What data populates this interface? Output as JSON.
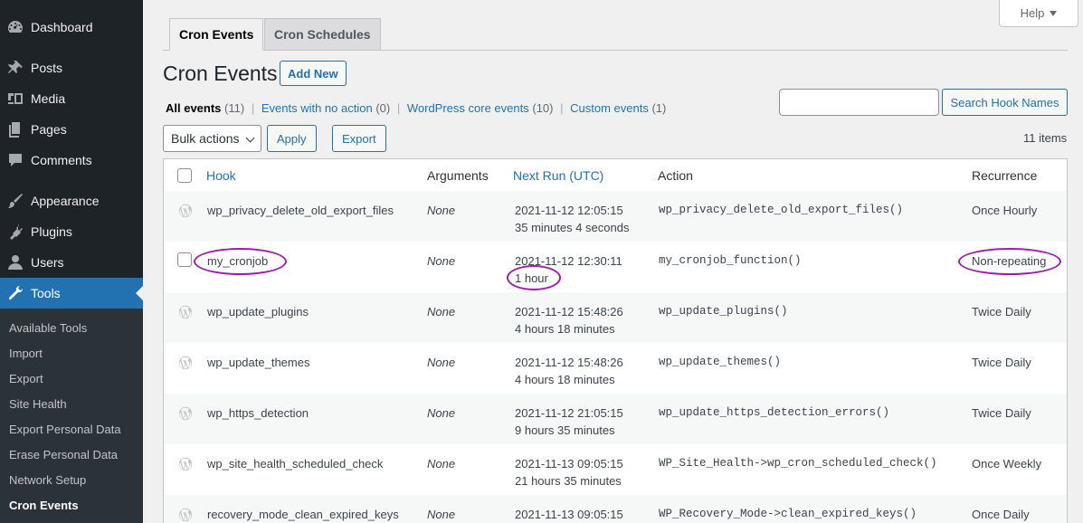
{
  "sidebar": {
    "items": [
      {
        "label": "Dashboard",
        "icon": "dashboard-icon",
        "current": false
      },
      {
        "label": "Posts",
        "icon": "pin-icon",
        "current": false
      },
      {
        "label": "Media",
        "icon": "media-icon",
        "current": false
      },
      {
        "label": "Pages",
        "icon": "pages-icon",
        "current": false
      },
      {
        "label": "Comments",
        "icon": "comments-icon",
        "current": false
      },
      {
        "label": "Appearance",
        "icon": "brush-icon",
        "current": false
      },
      {
        "label": "Plugins",
        "icon": "plugins-icon",
        "current": false
      },
      {
        "label": "Users",
        "icon": "users-icon",
        "current": false
      },
      {
        "label": "Tools",
        "icon": "wrench-icon",
        "current": true
      }
    ],
    "submenu": [
      {
        "label": "Available Tools"
      },
      {
        "label": "Import"
      },
      {
        "label": "Export"
      },
      {
        "label": "Site Health"
      },
      {
        "label": "Export Personal Data"
      },
      {
        "label": "Erase Personal Data"
      },
      {
        "label": "Network Setup"
      },
      {
        "label": "Cron Events",
        "current": true
      }
    ]
  },
  "help": {
    "label": "Help"
  },
  "tabs": [
    {
      "label": "Cron Events",
      "active": true
    },
    {
      "label": "Cron Schedules",
      "active": false
    }
  ],
  "page": {
    "title": "Cron Events",
    "add_new": "Add New"
  },
  "filters": [
    {
      "label": "All events",
      "count": "(11)",
      "current": true
    },
    {
      "label": "Events with no action",
      "count": "(0)"
    },
    {
      "label": "WordPress core events",
      "count": "(10)"
    },
    {
      "label": "Custom events",
      "count": "(1)"
    }
  ],
  "search": {
    "placeholder": "",
    "button": "Search Hook Names"
  },
  "toolbar": {
    "bulk_actions": "Bulk actions",
    "apply": "Apply",
    "export": "Export",
    "items_count": "11 items"
  },
  "table": {
    "columns": {
      "hook": "Hook",
      "arguments": "Arguments",
      "next_run": "Next Run (UTC)",
      "action": "Action",
      "recurrence": "Recurrence"
    },
    "rows": [
      {
        "hook": "wp_privacy_delete_old_export_files",
        "arguments": "None",
        "next_time": "2021-11-12 12:05:15",
        "next_in": "35 minutes 4 seconds",
        "action": "wp_privacy_delete_old_export_files()",
        "recurrence": "Once Hourly",
        "core": true
      },
      {
        "hook": "my_cronjob",
        "arguments": "None",
        "next_time": "2021-11-12 12:30:11",
        "next_in": "1 hour",
        "action": "my_cronjob_function()",
        "recurrence": "Non-repeating",
        "core": false
      },
      {
        "hook": "wp_update_plugins",
        "arguments": "None",
        "next_time": "2021-11-12 15:48:26",
        "next_in": "4 hours 18 minutes",
        "action": "wp_update_plugins()",
        "recurrence": "Twice Daily",
        "core": true
      },
      {
        "hook": "wp_update_themes",
        "arguments": "None",
        "next_time": "2021-11-12 15:48:26",
        "next_in": "4 hours 18 minutes",
        "action": "wp_update_themes()",
        "recurrence": "Twice Daily",
        "core": true
      },
      {
        "hook": "wp_https_detection",
        "arguments": "None",
        "next_time": "2021-11-12 21:05:15",
        "next_in": "9 hours 35 minutes",
        "action": "wp_update_https_detection_errors()",
        "recurrence": "Twice Daily",
        "core": true
      },
      {
        "hook": "wp_site_health_scheduled_check",
        "arguments": "None",
        "next_time": "2021-11-13 09:05:15",
        "next_in": "21 hours 35 minutes",
        "action": "WP_Site_Health->wp_cron_scheduled_check()",
        "recurrence": "Once Weekly",
        "core": true
      },
      {
        "hook": "recovery_mode_clean_expired_keys",
        "arguments": "None",
        "next_time": "2021-11-13 09:05:15",
        "next_in": "",
        "action": "WP_Recovery_Mode->clean_expired_keys()",
        "recurrence": "Once Daily",
        "core": true
      }
    ]
  },
  "colors": {
    "accent": "#2271b1",
    "sidebar": "#1d2327",
    "annotation": "#9b1ea8"
  }
}
